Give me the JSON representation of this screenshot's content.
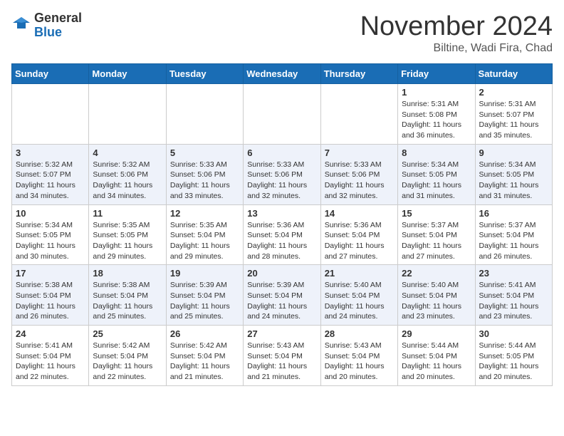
{
  "header": {
    "logo_general": "General",
    "logo_blue": "Blue",
    "month_title": "November 2024",
    "location": "Biltine, Wadi Fira, Chad"
  },
  "days_of_week": [
    "Sunday",
    "Monday",
    "Tuesday",
    "Wednesday",
    "Thursday",
    "Friday",
    "Saturday"
  ],
  "weeks": [
    [
      {
        "day": "",
        "info": ""
      },
      {
        "day": "",
        "info": ""
      },
      {
        "day": "",
        "info": ""
      },
      {
        "day": "",
        "info": ""
      },
      {
        "day": "",
        "info": ""
      },
      {
        "day": "1",
        "info": "Sunrise: 5:31 AM\nSunset: 5:08 PM\nDaylight: 11 hours and 36 minutes."
      },
      {
        "day": "2",
        "info": "Sunrise: 5:31 AM\nSunset: 5:07 PM\nDaylight: 11 hours and 35 minutes."
      }
    ],
    [
      {
        "day": "3",
        "info": "Sunrise: 5:32 AM\nSunset: 5:07 PM\nDaylight: 11 hours and 34 minutes."
      },
      {
        "day": "4",
        "info": "Sunrise: 5:32 AM\nSunset: 5:06 PM\nDaylight: 11 hours and 34 minutes."
      },
      {
        "day": "5",
        "info": "Sunrise: 5:33 AM\nSunset: 5:06 PM\nDaylight: 11 hours and 33 minutes."
      },
      {
        "day": "6",
        "info": "Sunrise: 5:33 AM\nSunset: 5:06 PM\nDaylight: 11 hours and 32 minutes."
      },
      {
        "day": "7",
        "info": "Sunrise: 5:33 AM\nSunset: 5:06 PM\nDaylight: 11 hours and 32 minutes."
      },
      {
        "day": "8",
        "info": "Sunrise: 5:34 AM\nSunset: 5:05 PM\nDaylight: 11 hours and 31 minutes."
      },
      {
        "day": "9",
        "info": "Sunrise: 5:34 AM\nSunset: 5:05 PM\nDaylight: 11 hours and 31 minutes."
      }
    ],
    [
      {
        "day": "10",
        "info": "Sunrise: 5:34 AM\nSunset: 5:05 PM\nDaylight: 11 hours and 30 minutes."
      },
      {
        "day": "11",
        "info": "Sunrise: 5:35 AM\nSunset: 5:05 PM\nDaylight: 11 hours and 29 minutes."
      },
      {
        "day": "12",
        "info": "Sunrise: 5:35 AM\nSunset: 5:04 PM\nDaylight: 11 hours and 29 minutes."
      },
      {
        "day": "13",
        "info": "Sunrise: 5:36 AM\nSunset: 5:04 PM\nDaylight: 11 hours and 28 minutes."
      },
      {
        "day": "14",
        "info": "Sunrise: 5:36 AM\nSunset: 5:04 PM\nDaylight: 11 hours and 27 minutes."
      },
      {
        "day": "15",
        "info": "Sunrise: 5:37 AM\nSunset: 5:04 PM\nDaylight: 11 hours and 27 minutes."
      },
      {
        "day": "16",
        "info": "Sunrise: 5:37 AM\nSunset: 5:04 PM\nDaylight: 11 hours and 26 minutes."
      }
    ],
    [
      {
        "day": "17",
        "info": "Sunrise: 5:38 AM\nSunset: 5:04 PM\nDaylight: 11 hours and 26 minutes."
      },
      {
        "day": "18",
        "info": "Sunrise: 5:38 AM\nSunset: 5:04 PM\nDaylight: 11 hours and 25 minutes."
      },
      {
        "day": "19",
        "info": "Sunrise: 5:39 AM\nSunset: 5:04 PM\nDaylight: 11 hours and 25 minutes."
      },
      {
        "day": "20",
        "info": "Sunrise: 5:39 AM\nSunset: 5:04 PM\nDaylight: 11 hours and 24 minutes."
      },
      {
        "day": "21",
        "info": "Sunrise: 5:40 AM\nSunset: 5:04 PM\nDaylight: 11 hours and 24 minutes."
      },
      {
        "day": "22",
        "info": "Sunrise: 5:40 AM\nSunset: 5:04 PM\nDaylight: 11 hours and 23 minutes."
      },
      {
        "day": "23",
        "info": "Sunrise: 5:41 AM\nSunset: 5:04 PM\nDaylight: 11 hours and 23 minutes."
      }
    ],
    [
      {
        "day": "24",
        "info": "Sunrise: 5:41 AM\nSunset: 5:04 PM\nDaylight: 11 hours and 22 minutes."
      },
      {
        "day": "25",
        "info": "Sunrise: 5:42 AM\nSunset: 5:04 PM\nDaylight: 11 hours and 22 minutes."
      },
      {
        "day": "26",
        "info": "Sunrise: 5:42 AM\nSunset: 5:04 PM\nDaylight: 11 hours and 21 minutes."
      },
      {
        "day": "27",
        "info": "Sunrise: 5:43 AM\nSunset: 5:04 PM\nDaylight: 11 hours and 21 minutes."
      },
      {
        "day": "28",
        "info": "Sunrise: 5:43 AM\nSunset: 5:04 PM\nDaylight: 11 hours and 20 minutes."
      },
      {
        "day": "29",
        "info": "Sunrise: 5:44 AM\nSunset: 5:04 PM\nDaylight: 11 hours and 20 minutes."
      },
      {
        "day": "30",
        "info": "Sunrise: 5:44 AM\nSunset: 5:05 PM\nDaylight: 11 hours and 20 minutes."
      }
    ]
  ]
}
